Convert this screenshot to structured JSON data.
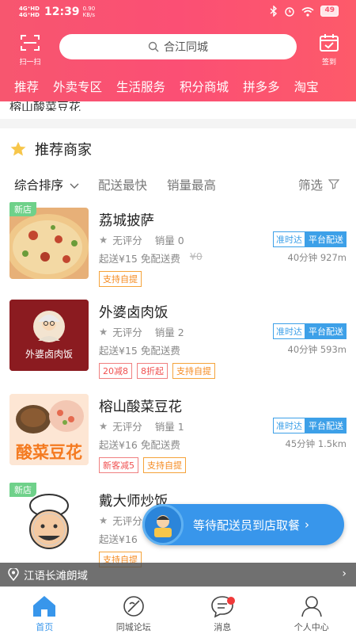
{
  "status_bar": {
    "network_top": "4G⁺HD",
    "network_bottom": "4G⁺HD",
    "time": "12:39",
    "speed_value": "0.90",
    "speed_unit": "KB/s",
    "battery": "49"
  },
  "header": {
    "scan_label": "扫一扫",
    "search_placeholder": "合江同城",
    "checkin_label": "签到"
  },
  "categories": [
    "推荐",
    "外卖专区",
    "生活服务",
    "积分商城",
    "拼多多",
    "淘宝"
  ],
  "previous_item": "榕山酸菜豆花",
  "section": {
    "title": "推荐商家"
  },
  "sort_bar": {
    "default": "综合排序",
    "fastest": "配送最快",
    "sales": "销量最高",
    "filter": "筛选"
  },
  "shops": [
    {
      "new_tag": "新店",
      "name": "荔城披萨",
      "rating": "无评分",
      "sales": "销量 0",
      "min_order": "起送¥15",
      "delivery": "免配送费",
      "old_fee": "¥0",
      "badge1": "准时达",
      "badge2": "平台配送",
      "time_dist": "40分钟 927m",
      "tags": [
        "支持自提"
      ]
    },
    {
      "name": "外婆卤肉饭",
      "rating": "无评分",
      "sales": "销量 2",
      "min_order": "起送¥15",
      "delivery": "免配送费",
      "badge1": "准时达",
      "badge2": "平台配送",
      "time_dist": "40分钟 593m",
      "tags_red": [
        "20减8",
        "8折起"
      ],
      "tags": [
        "支持自提"
      ]
    },
    {
      "name": "榕山酸菜豆花",
      "rating": "无评分",
      "sales": "销量 1",
      "min_order": "起送¥16",
      "delivery": "免配送费",
      "badge1": "准时达",
      "badge2": "平台配送",
      "time_dist": "45分钟 1.5km",
      "tags_red": [
        "新客减5"
      ],
      "tags": [
        "支持自提"
      ],
      "image_text": "酸菜豆花"
    },
    {
      "new_tag": "新店",
      "name": "戴大师炒饭",
      "rating": "无评分",
      "min_order": "起送¥16",
      "tags": [
        "支持自提"
      ]
    }
  ],
  "image_brand_text": "外婆卤肉饭",
  "floating_banner": {
    "text": "等待配送员到店取餐"
  },
  "location_bar": {
    "text": "江语长滩朗域"
  },
  "tabbar": [
    {
      "label": "首页",
      "icon": "home-icon"
    },
    {
      "label": "同城论坛",
      "icon": "forum-icon"
    },
    {
      "label": "消息",
      "icon": "message-icon"
    },
    {
      "label": "个人中心",
      "icon": "user-icon"
    }
  ],
  "colors": {
    "brand": "#f7566f",
    "accent_blue": "#3896eb",
    "tag_orange": "#f58a1f"
  }
}
